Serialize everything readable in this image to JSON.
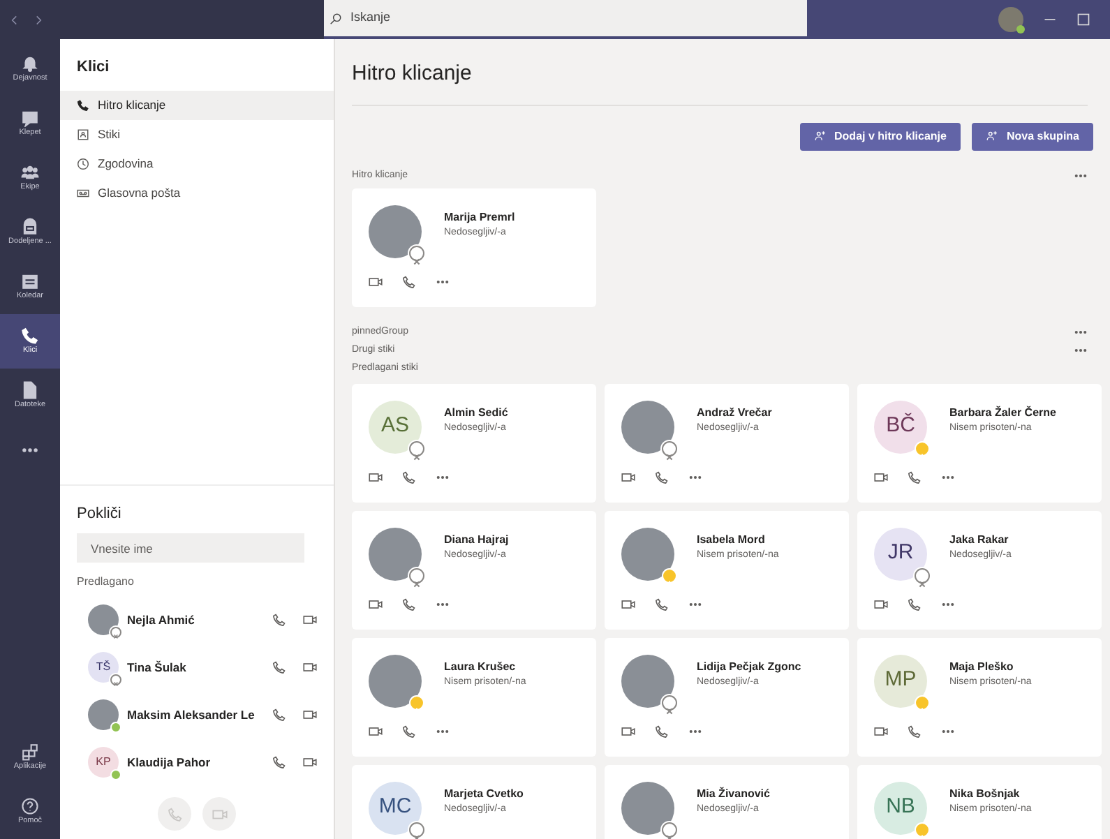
{
  "titlebar": {
    "search": {
      "placeholder": "Iskanje"
    }
  },
  "rail": {
    "items": [
      {
        "label": "Dejavnost",
        "selected": false
      },
      {
        "label": "Klepet",
        "selected": false
      },
      {
        "label": "Ekipe",
        "selected": false
      },
      {
        "label": "Dodeljene ...",
        "selected": false
      },
      {
        "label": "Koledar",
        "selected": false
      },
      {
        "label": "Klici",
        "selected": true
      },
      {
        "label": "Datoteke",
        "selected": false
      }
    ],
    "bottom_items": [
      {
        "label": "Aplikacije",
        "selected": false
      },
      {
        "label": "Pomoč",
        "selected": false
      }
    ]
  },
  "panel": {
    "title": "Klici",
    "nav": [
      {
        "label": "Hitro klicanje",
        "selected": true
      },
      {
        "label": "Stiki",
        "selected": false
      },
      {
        "label": "Zgodovina",
        "selected": false
      },
      {
        "label": "Glasovna pošta",
        "selected": false
      }
    ],
    "dial": {
      "title": "Pokliči",
      "input": {
        "placeholder": "Vnesite ime"
      },
      "suggested_label": "Predlagano",
      "suggestions": [
        {
          "name": "Nejla Ahmić",
          "avatar": {
            "kind": "photo"
          },
          "presence": {
            "kind": "offline"
          }
        },
        {
          "name": "Tina Šulak",
          "avatar": {
            "kind": "initials",
            "text": "TŠ",
            "color": "#e3e2f3"
          },
          "presence": {
            "kind": "offline"
          }
        },
        {
          "name": "Maksim Aleksander Le",
          "avatar": {
            "kind": "photo"
          },
          "presence": {
            "kind": "available"
          }
        },
        {
          "name": "Klaudija Pahor",
          "avatar": {
            "kind": "initials",
            "text": "KP",
            "color": "#f3dde2"
          },
          "presence": {
            "kind": "available"
          }
        }
      ]
    }
  },
  "main": {
    "title": "Hitro klicanje",
    "buttons": [
      "Dodaj v hitro klicanje",
      "Nova skupina"
    ],
    "speed_dial": {
      "label": "Hitro klicanje",
      "contacts": [
        {
          "name": "Marija Premrl",
          "status": "Nedosegljiv/-a",
          "presence": {
            "kind": "offline"
          },
          "avatar": {
            "kind": "photo"
          }
        }
      ]
    },
    "sections": [
      {
        "label": "pinnedGroup",
        "menu": true
      },
      {
        "label": "Drugi stiki",
        "menu": true
      },
      {
        "label": "Predlagani stiki",
        "menu": false
      }
    ],
    "suggested_contacts": [
      {
        "name": "Almin Sedić",
        "status": "Nedosegljiv/-a",
        "presence": {
          "kind": "offline"
        },
        "avatar": {
          "kind": "initials",
          "text": "AS",
          "color": "#e4ecd9"
        }
      },
      {
        "name": "Andraž Vrečar",
        "status": "Nedosegljiv/-a",
        "presence": {
          "kind": "offline"
        },
        "avatar": {
          "kind": "photo"
        }
      },
      {
        "name": "Barbara Žaler Černe",
        "status": "Nisem prisoten/-na",
        "presence": {
          "kind": "away"
        },
        "avatar": {
          "kind": "initials",
          "text": "BČ",
          "color": "#f1dfea"
        }
      },
      {
        "name": "Diana Hajraj",
        "status": "Nedosegljiv/-a",
        "presence": {
          "kind": "offline"
        },
        "avatar": {
          "kind": "photo"
        }
      },
      {
        "name": "Isabela Mord",
        "status": "Nisem prisoten/-na",
        "presence": {
          "kind": "away"
        },
        "avatar": {
          "kind": "photo"
        }
      },
      {
        "name": "Jaka Rakar",
        "status": "Nedosegljiv/-a",
        "presence": {
          "kind": "offline"
        },
        "avatar": {
          "kind": "initials",
          "text": "JR",
          "color": "#e6e3f3"
        }
      },
      {
        "name": "Laura Krušec",
        "status": "Nisem prisoten/-na",
        "presence": {
          "kind": "away"
        },
        "avatar": {
          "kind": "photo"
        }
      },
      {
        "name": "Lidija Pečjak Zgonc",
        "status": "Nedosegljiv/-a",
        "presence": {
          "kind": "offline"
        },
        "avatar": {
          "kind": "photo"
        }
      },
      {
        "name": "Maja Pleško",
        "status": "Nisem prisoten/-na",
        "presence": {
          "kind": "away"
        },
        "avatar": {
          "kind": "initials",
          "text": "MP",
          "color": "#e6ead9"
        }
      },
      {
        "name": "Marjeta Cvetko",
        "status": "Nedosegljiv/-a",
        "presence": {
          "kind": "offline"
        },
        "avatar": {
          "kind": "initials",
          "text": "MC",
          "color": "#d9e2f1"
        }
      },
      {
        "name": "Mia Živanović",
        "status": "Nedosegljiv/-a",
        "presence": {
          "kind": "offline"
        },
        "avatar": {
          "kind": "photo"
        }
      },
      {
        "name": "Nika Bošnjak",
        "status": "Nisem prisoten/-na",
        "presence": {
          "kind": "away"
        },
        "avatar": {
          "kind": "initials",
          "text": "NB",
          "color": "#d8ece2"
        }
      }
    ]
  }
}
